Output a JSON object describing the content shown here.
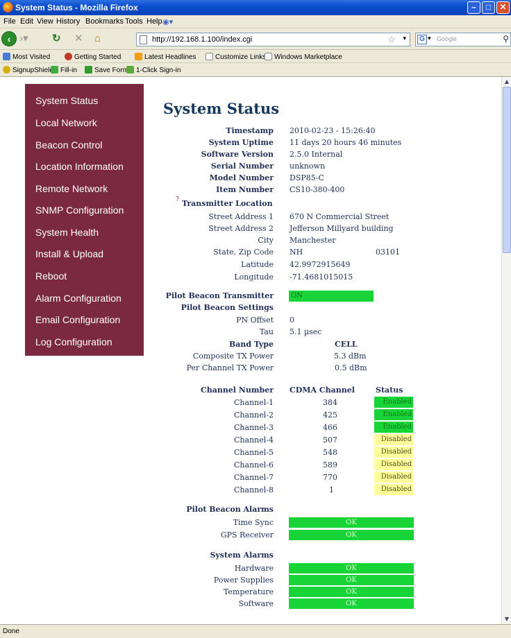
{
  "window": {
    "title": "System Status - Mozilla Firefox"
  },
  "menu": [
    "File",
    "Edit",
    "View",
    "History",
    "Bookmarks",
    "Tools",
    "Help"
  ],
  "nav": {
    "url": "http://192.168.1.100/index.cgi",
    "search_placeholder": "Google"
  },
  "bookmarks": [
    "Most Visited",
    "Getting Started",
    "Latest Headlines",
    "Customize Links",
    "Windows Marketplace"
  ],
  "toolbar2": [
    "SignupShield",
    "Fill-in",
    "Save Form",
    "1-Click Sign-in"
  ],
  "status": "Done",
  "sidebar": [
    "System Status",
    "Local Network",
    "Beacon Control",
    "Location Information",
    "Remote Network",
    "SNMP Configuration",
    "System Health",
    "Install & Upload",
    "Reboot",
    "Alarm Configuration",
    "Email Configuration",
    "Log Configuration"
  ],
  "page": {
    "title": "System Status",
    "info": [
      {
        "label": "Timestamp",
        "value": "2010-02-23 - 15:26:40"
      },
      {
        "label": "System Uptime",
        "value": "11 days 20 hours 46 minutes"
      },
      {
        "label": "Software Version",
        "value": "2.5.0 Internal"
      },
      {
        "label": "Serial Number",
        "value": "unknown"
      },
      {
        "label": "Model Number",
        "value": "DSP85-C"
      },
      {
        "label": "Item Number",
        "value": "CS10-380-400"
      }
    ],
    "location": {
      "help": "?",
      "heading": "Transmitter Location",
      "street1_label": "Street Address 1",
      "street1": "670 N Commercial Street",
      "street2_label": "Street Address 2",
      "street2": "Jefferson Millyard building",
      "city_label": "City",
      "city": "Manchester",
      "state_label": "State, Zip Code",
      "state": "NH",
      "zip": "03101",
      "lat_label": "Latitude",
      "lat": "42.9972915649",
      "lon_label": "Longitude",
      "lon": "-71.4681015015"
    },
    "beacon": {
      "tx_label": "Pilot Beacon Transmitter",
      "tx_value": "ON",
      "settings_label": "Pilot Beacon Settings",
      "pn_label": "PN Offset",
      "pn": "0",
      "tau_label": "Tau",
      "tau": "5.1 µsec",
      "band_label": "Band Type",
      "band": "CELL",
      "comp_label": "Composite TX Power",
      "comp": "5.3 dBm",
      "perch_label": "Per Channel TX Power",
      "perch": "0.5 dBm"
    },
    "channel_headers": {
      "number": "Channel Number",
      "cdma": "CDMA Channel",
      "status": "Status"
    },
    "channels": [
      {
        "name": "Channel-1",
        "cdma": "384",
        "status": "Enabled"
      },
      {
        "name": "Channel-2",
        "cdma": "425",
        "status": "Enabled"
      },
      {
        "name": "Channel-3",
        "cdma": "466",
        "status": "Enabled"
      },
      {
        "name": "Channel-4",
        "cdma": "507",
        "status": "Disabled"
      },
      {
        "name": "Channel-5",
        "cdma": "548",
        "status": "Disabled"
      },
      {
        "name": "Channel-6",
        "cdma": "589",
        "status": "Disabled"
      },
      {
        "name": "Channel-7",
        "cdma": "770",
        "status": "Disabled"
      },
      {
        "name": "Channel-8",
        "cdma": "1",
        "status": "Disabled"
      }
    ],
    "pilot_alarms": {
      "heading": "Pilot Beacon Alarms",
      "items": [
        {
          "label": "Time Sync",
          "value": "OK"
        },
        {
          "label": "GPS Receiver",
          "value": "OK"
        }
      ]
    },
    "system_alarms": {
      "heading": "System Alarms",
      "items": [
        {
          "label": "Hardware",
          "value": "OK"
        },
        {
          "label": "Power Supplies",
          "value": "OK"
        },
        {
          "label": "Temperature",
          "value": "OK"
        },
        {
          "label": "Software",
          "value": "OK"
        }
      ]
    }
  },
  "colors": {
    "sidebar": "#7b2942",
    "heading": "#16375c",
    "enabled": "#19d437",
    "disabled": "#ffff99"
  }
}
